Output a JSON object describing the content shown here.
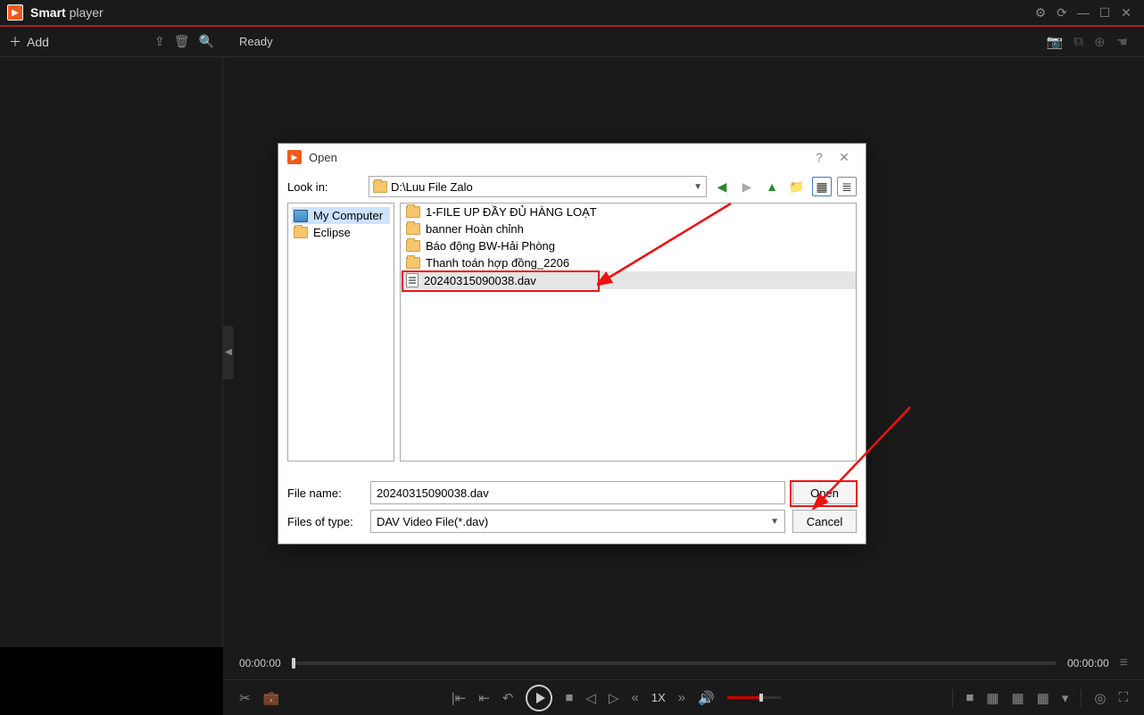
{
  "title_bar": {
    "brand_bold": "Smart",
    "brand_light": " player"
  },
  "tool_row": {
    "add_label": "Add",
    "status": "Ready"
  },
  "timeline": {
    "current": "00:00:00",
    "total": "00:00:00"
  },
  "controls": {
    "speed": "1X"
  },
  "dialog": {
    "title": "Open",
    "look_in_label": "Look in:",
    "look_in_value": "D:\\Luu File Zalo",
    "tree": {
      "my_computer": "My Computer",
      "eclipse": "Eclipse"
    },
    "files": [
      "1-FILE UP ĐẦY ĐỦ HÀNG LOẠT",
      "banner Hoàn chỉnh",
      "Báo động BW-Hải Phòng",
      "Thanh toán hợp đồng_2206",
      "20240315090038.dav"
    ],
    "filename_label": "File name:",
    "filename_value": "20240315090038.dav",
    "filetype_label": "Files of type:",
    "filetype_value": "DAV Video File(*.dav)",
    "open_btn": "Open",
    "cancel_btn": "Cancel"
  }
}
